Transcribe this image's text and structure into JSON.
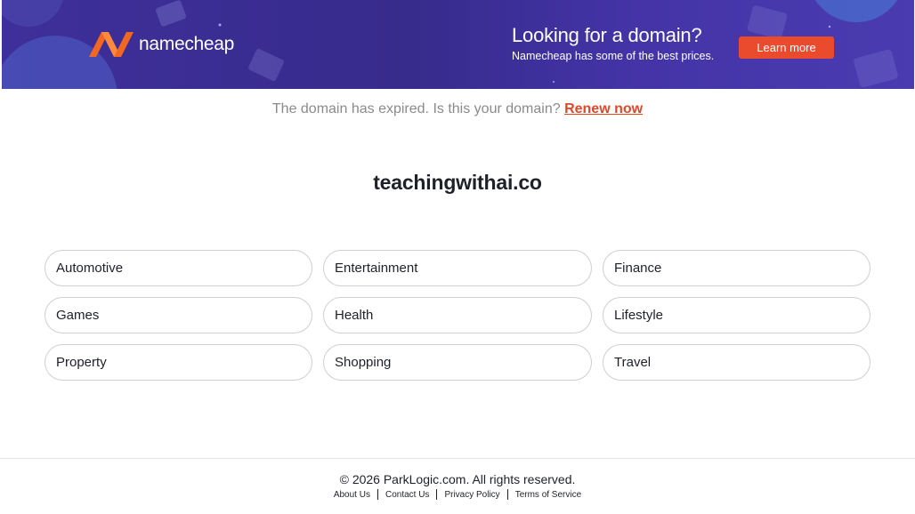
{
  "banner": {
    "logo_text": "namecheap",
    "promo_title": "Looking for a domain?",
    "promo_subtitle": "Namecheap has some of the best prices.",
    "cta_label": "Learn more",
    "colors": {
      "background": "#3e2f9a",
      "cta": "#ea4b2c",
      "logo_orange": "#f26822"
    }
  },
  "notice": {
    "text": "The domain has expired. Is this your domain?",
    "link_label": "Renew now"
  },
  "domain_name": "teachingwithai.co",
  "categories": [
    "Automotive",
    "Entertainment",
    "Finance",
    "Games",
    "Health",
    "Lifestyle",
    "Property",
    "Shopping",
    "Travel"
  ],
  "footer": {
    "copyright": "© 2026 ParkLogic.com. All rights reserved.",
    "links": [
      "About Us",
      "Contact Us",
      "Privacy Policy",
      "Terms of Service"
    ]
  }
}
